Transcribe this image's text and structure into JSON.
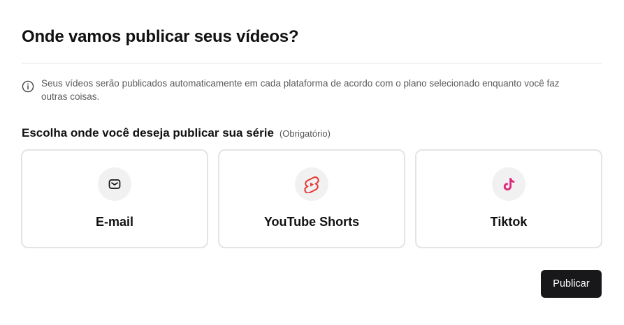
{
  "dialog": {
    "title": "Onde vamos publicar seus vídeos?",
    "info_text": "Seus vídeos serão publicados automaticamente em cada plataforma de acordo com o plano selecionado enquanto você faz outras coisas.",
    "info_icon": "info-circle-icon"
  },
  "destination": {
    "label": "Escolha onde você deseja publicar sua série",
    "required_label": "(Obrigatório)",
    "options": [
      {
        "label": "E-mail",
        "icon": "mail-icon",
        "icon_color": "#111111"
      },
      {
        "label": "YouTube Shorts",
        "icon": "youtube-shorts-icon",
        "icon_color": "#e53935"
      },
      {
        "label": "Tiktok",
        "icon": "tiktok-icon",
        "icon_color": "#e0247a"
      }
    ]
  },
  "actions": {
    "publish_label": "Publicar"
  },
  "colors": {
    "primary_button": "#18181b",
    "card_border": "#e4e4e4",
    "icon_bg": "#f1f1f1"
  }
}
